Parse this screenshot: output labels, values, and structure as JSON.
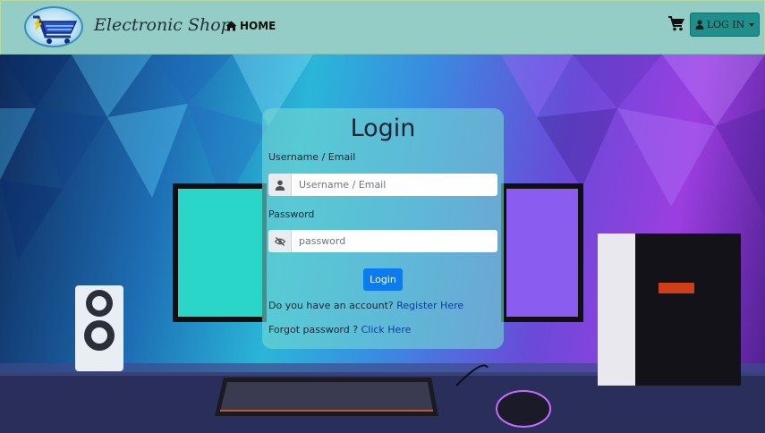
{
  "navbar": {
    "brand": "Electronic Shop",
    "home_label": "HOME",
    "login_label": "LOG IN",
    "logo_icon": "cart-logo-icon",
    "cart_icon": "shopping-cart-icon"
  },
  "login": {
    "title": "Login",
    "username_label": "Username / Email",
    "username_placeholder": "Username / Email",
    "password_label": "Password",
    "password_placeholder": "password",
    "submit_label": "Login",
    "register_text": "Do you have an account? ",
    "register_link": "Register Here",
    "forgot_text": "Forgot password ? ",
    "forgot_link": "Click Here"
  },
  "colors": {
    "navbar_bg": "#93cdc5",
    "login_button": "#1f8f8b",
    "submit_button": "#0d7bf0"
  }
}
